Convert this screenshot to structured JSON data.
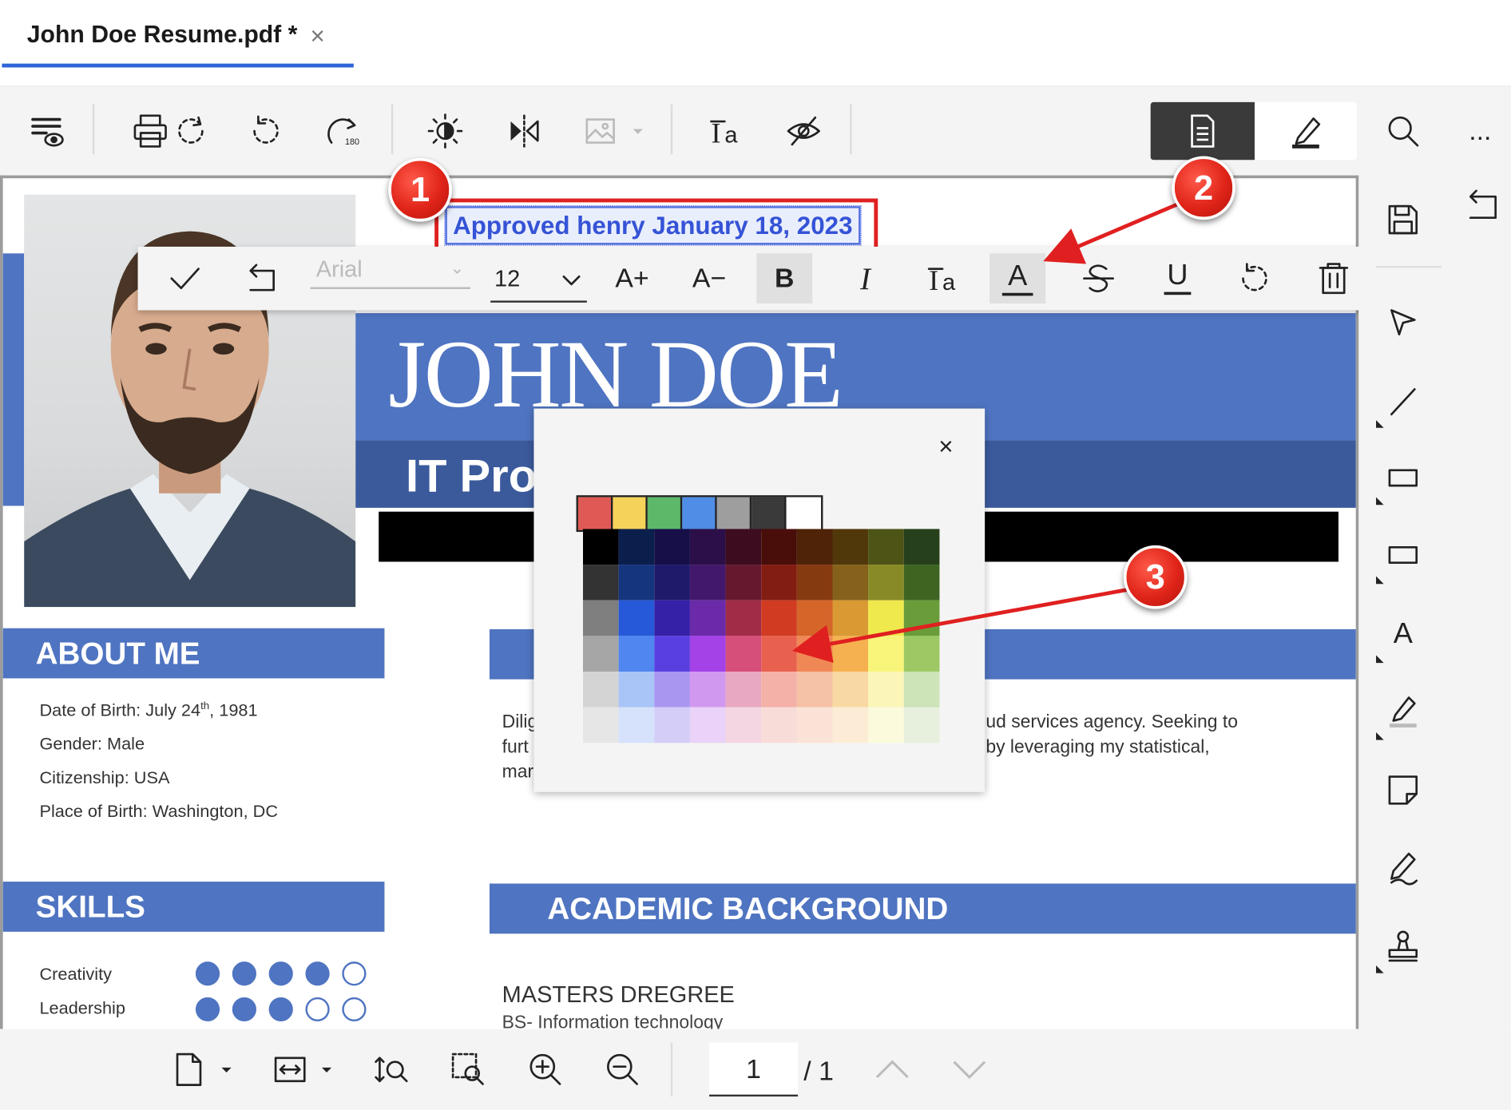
{
  "tab": {
    "title": "John Doe Resume.pdf *",
    "close": "×"
  },
  "toolbar": {
    "icons": [
      "view-settings-icon",
      "print-icon",
      "rotate-left-icon",
      "rotate-180-icon",
      "brightness-icon",
      "flip-icon",
      "image-icon",
      "text-tool-icon",
      "hide-icon"
    ],
    "modes": [
      "document-icon",
      "annotation-pen-icon"
    ],
    "search": "search-icon",
    "more": "..."
  },
  "annotation": {
    "text": "Approved henry January 18, 2023"
  },
  "format_bar": {
    "font": "Arial",
    "size": "12",
    "bold": "B",
    "italic": "I",
    "increase": "A+",
    "decrease": "A−",
    "underline": "U",
    "color_letter": "A"
  },
  "color_picker": {
    "close": "×",
    "recent": [
      "#e05a55",
      "#f5d35a",
      "#5db86a",
      "#4f8de6",
      "#9e9e9e",
      "#3a3a3a",
      "#ffffff"
    ],
    "rows": [
      [
        "#000000",
        "#0b1f4d",
        "#160f48",
        "#2c0f48",
        "#3d0d1f",
        "#4a0e0a",
        "#4f2308",
        "#51380b",
        "#4e5416",
        "#26401b"
      ],
      [
        "#333333",
        "#15357f",
        "#1f1a6a",
        "#42186c",
        "#66192e",
        "#821d12",
        "#863a10",
        "#86611b",
        "#888a26",
        "#3e6422"
      ],
      [
        "#7f7f7f",
        "#2559d9",
        "#3520a8",
        "#6a2aa9",
        "#a02c48",
        "#d13b21",
        "#d6652a",
        "#d99a33",
        "#f0e94d",
        "#6a9c3a"
      ],
      [
        "#a6a6a6",
        "#4f86f0",
        "#5a3fe0",
        "#a442e8",
        "#d64e7a",
        "#e8614f",
        "#f08856",
        "#f5b14f",
        "#f8f57a",
        "#9dc964"
      ],
      [
        "#d4d4d4",
        "#a9c4f6",
        "#a896f0",
        "#d198f0",
        "#e8a8c2",
        "#f4b1a8",
        "#f5c2a6",
        "#f9d9a3",
        "#fbf6b8",
        "#cde3b8"
      ],
      [
        "#e6e6e6",
        "#d6e2fb",
        "#d3cdf8",
        "#ead2f8",
        "#f3d6e2",
        "#f8dcd7",
        "#fae3d6",
        "#fcecd6",
        "#fcfadd",
        "#e6f0dd"
      ]
    ]
  },
  "resume": {
    "name": "JOHN DOE",
    "subtitle": "IT Proj",
    "about_heading": "ABOUT ME",
    "dob_label": "Date of Birth: July 24",
    "dob_sup": "th",
    "dob_year": ", 1981",
    "gender": "Gender: Male",
    "citizenship": "Citizenship: USA",
    "pob": "Place of Birth: Washington, DC",
    "skills_heading": "SKILLS",
    "skills": [
      {
        "name": "Creativity",
        "level": 4,
        "max": 5
      },
      {
        "name": "Leadership",
        "level": 3,
        "max": 5
      }
    ],
    "profile_left": [
      "Dilig",
      "furt",
      "mar"
    ],
    "profile_right": [
      "ud services agency. Seeking to",
      "by leveraging my statistical,"
    ],
    "academic_heading": "ACADEMIC BACKGROUND",
    "masters": "MASTERS DREGREE",
    "bs": "BS- Information technology"
  },
  "sidebar": {
    "tools": [
      "save-icon",
      "select-arrow-icon",
      "line-icon",
      "rectangle-icon",
      "filled-rectangle-icon",
      "text-annotation-icon",
      "highlighter-icon",
      "sticky-note-icon",
      "signature-icon",
      "stamp-icon"
    ],
    "text_tool_letter": "A",
    "panel_icon": "panel-toggle-icon"
  },
  "bottom": {
    "page": "1",
    "total": "/ 1"
  },
  "callouts": [
    "1",
    "2",
    "3"
  ]
}
